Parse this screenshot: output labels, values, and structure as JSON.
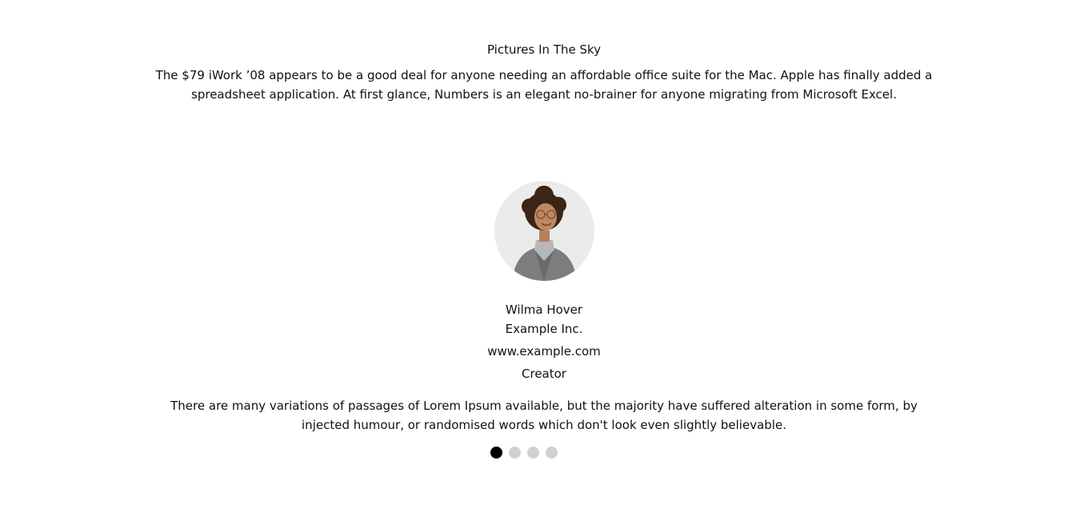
{
  "intro": {
    "title": "Pictures In The Sky",
    "text": "The $79 iWork ’08 appears to be a good deal for anyone needing an affordable office suite for the Mac. Apple has finally added a spreadsheet application. At first glance, Numbers is an elegant no-brainer for anyone migrating from Microsoft Excel."
  },
  "testimonial": {
    "name": "Wilma Hover",
    "company": "Example Inc.",
    "website": "www.example.com",
    "role": "Creator",
    "quote": "There are many variations of passages of Lorem Ipsum available, but the majority have suffered alteration in some form, by injected humour, or randomised words which don't look even slightly believable."
  },
  "carousel": {
    "slide_count": 4,
    "active_index": 0,
    "active_color": "#000000",
    "inactive_color": "#d0d0d0"
  }
}
